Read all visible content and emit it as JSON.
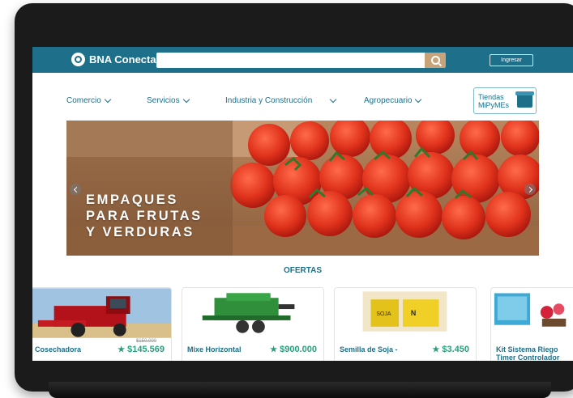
{
  "header": {
    "brand": "BNA Conecta",
    "search_placeholder": "",
    "login_label": "Ingresar"
  },
  "nav": {
    "items": [
      {
        "label": "Comercio"
      },
      {
        "label": "Servicios"
      },
      {
        "label": "Industria y Construcción"
      },
      {
        "label": "Agropecuario"
      }
    ],
    "tiendas_line1": "Tiendas",
    "tiendas_line2": "MiPyMEs"
  },
  "banner": {
    "line1": "EMPAQUES",
    "line2": "PARA FRUTAS",
    "line3": "Y VERDURAS"
  },
  "offers": {
    "title": "OFERTAS",
    "cards": [
      {
        "name": "Cosechadora",
        "price": "$145.569",
        "old_price": "$150.000",
        "image": "red-harvester"
      },
      {
        "name": "Mixe Horizontal",
        "price": "$900.000",
        "old_price": "",
        "image": "green-mixer"
      },
      {
        "name": "Semilla de Soja -",
        "price": "$3.450",
        "old_price": "",
        "image": "soy-seed-bag"
      },
      {
        "name_line1": "Kit Sistema Riego",
        "name_line2": "Timer Controlador",
        "price": "",
        "image": "irrigation-kit"
      }
    ]
  },
  "colors": {
    "brand": "#1d6f8a",
    "accent": "#c8a37a",
    "price": "#2b9e7e"
  }
}
